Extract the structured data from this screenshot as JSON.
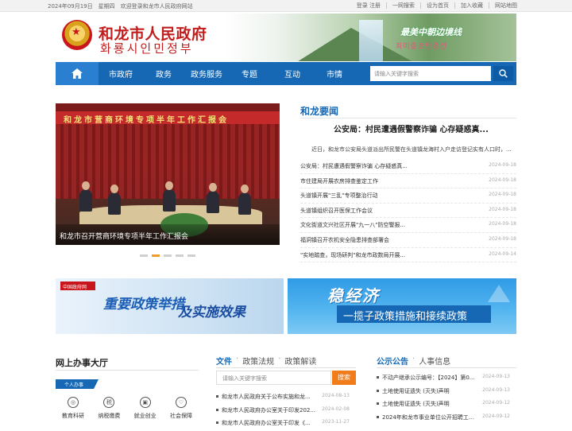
{
  "topbar": {
    "date_text": "2024年09月19日　星期四　欢迎登录和龙市人民政府网站",
    "links": [
      "登录 注册",
      "一网搜索",
      "设为首页",
      "加入收藏",
      "网站地图"
    ]
  },
  "header": {
    "title_cn": "和龙市人民政府",
    "title_kr": "화룡시인민정부",
    "banner_slogan": "最美中朝边境线",
    "banner_slogan_kr": "최미중조변경선"
  },
  "nav": {
    "items": [
      "市政府",
      "政务",
      "政务服务",
      "专题",
      "互动",
      "市情"
    ],
    "search_placeholder": "请输入关键字搜索"
  },
  "slider": {
    "board_text": "和龙市营商环境专项半年工作汇报会",
    "caption": "和龙市召开营商环境专项半年工作汇报会"
  },
  "news": {
    "heading": "和龙要闻",
    "headline": "公安局：村民遭遇假警察诈骗 心存疑惑真...",
    "summary": "近日，和龙市公安局头道派出所民警在头道镇龙海村入户走访登记实有人口时，...",
    "items": [
      {
        "title": "公安局：村民遭遇假警察诈骗 心存疑惑真...",
        "date": "2024-09-18"
      },
      {
        "title": "市住建局开展农房排查鉴定工作",
        "date": "2024-09-18"
      },
      {
        "title": "头道镇开展\"三乱\"专项整治行动",
        "date": "2024-09-18"
      },
      {
        "title": "头道镇组织召开医保工作会议",
        "date": "2024-09-18"
      },
      {
        "title": "文化街道文兴社区开展\"九一八\"防空警报...",
        "date": "2024-09-18"
      },
      {
        "title": "福洞镇召开农机安全隐患排查部署会",
        "date": "2024-09-18"
      },
      {
        "title": "\"实地踏查，现场研判\"和龙市政数局开展...",
        "date": "2024-09-14"
      }
    ]
  },
  "banners": {
    "left_tag": "中国政府网",
    "left_t1": "重要政策举措",
    "left_t2": "及实施效果",
    "right_t1": "稳经济",
    "right_t2": "一揽子政策措施和接续政策"
  },
  "service": {
    "heading": "网上办事大厅",
    "tab": "个人办事",
    "icons": [
      {
        "label": "教育科研",
        "glyph": "◎",
        "icon": "education-icon"
      },
      {
        "label": "纳税缴费",
        "glyph": "税",
        "icon": "tax-icon"
      },
      {
        "label": "就业创业",
        "glyph": "▣",
        "icon": "employment-icon"
      },
      {
        "label": "社会保障",
        "glyph": "♡",
        "icon": "social-security-icon"
      }
    ]
  },
  "docs": {
    "tab_active": "文件",
    "tab2": "政策法规",
    "tab3": "政策解读",
    "search_placeholder": "请输入关键字搜索",
    "search_button": "搜索",
    "items": [
      {
        "title": "和龙市人民政府关于公布实施和龙...",
        "date": "2024-08-13"
      },
      {
        "title": "和龙市人民政府办公室关于印发202...",
        "date": "2024-02-08"
      },
      {
        "title": "和龙市人民政府办公室关于印发《...",
        "date": "2023-11-27"
      }
    ]
  },
  "announce": {
    "tab_active": "公示公告",
    "tab2": "人事信息",
    "items": [
      {
        "title": "不动产继承公示编号：【2024】第0...",
        "date": "2024-09-13"
      },
      {
        "title": "土地使用证遗失 (灭失)声明",
        "date": "2024-09-13"
      },
      {
        "title": "土地使用证遗失 (灭失)声明",
        "date": "2024-09-12"
      },
      {
        "title": "2024年和龙市事业单位公开招聘工...",
        "date": "2024-09-12"
      }
    ]
  }
}
